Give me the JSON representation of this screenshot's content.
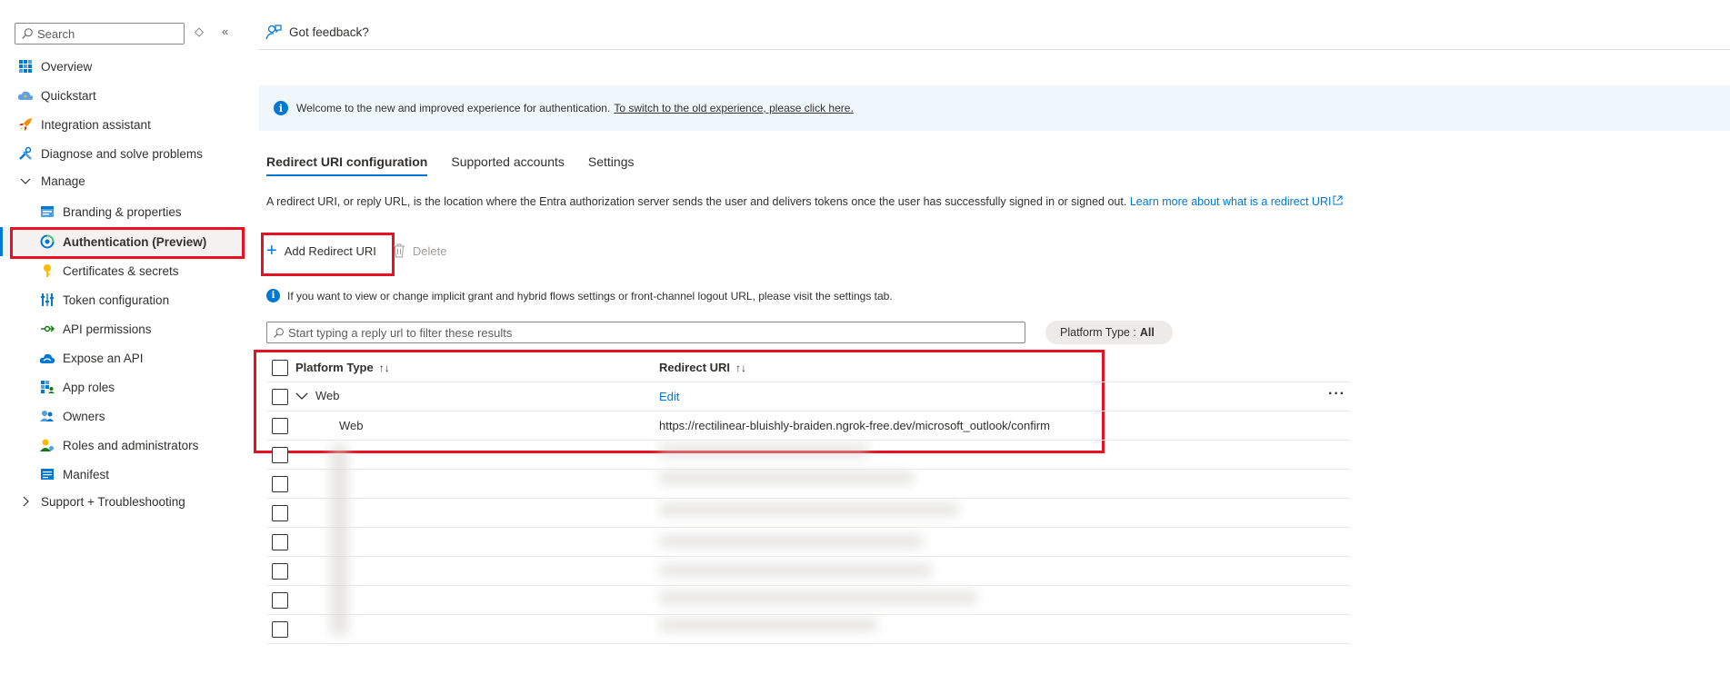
{
  "sidebar": {
    "search_placeholder": "Search",
    "items": [
      {
        "label": "Overview"
      },
      {
        "label": "Quickstart"
      },
      {
        "label": "Integration assistant"
      },
      {
        "label": "Diagnose and solve problems"
      },
      {
        "label": "Manage"
      },
      {
        "label": "Branding & properties"
      },
      {
        "label": "Authentication (Preview)"
      },
      {
        "label": "Certificates & secrets"
      },
      {
        "label": "Token configuration"
      },
      {
        "label": "API permissions"
      },
      {
        "label": "Expose an API"
      },
      {
        "label": "App roles"
      },
      {
        "label": "Owners"
      },
      {
        "label": "Roles and administrators"
      },
      {
        "label": "Manifest"
      },
      {
        "label": "Support + Troubleshooting"
      }
    ]
  },
  "header": {
    "feedback_label": "Got feedback?"
  },
  "banner": {
    "text": "Welcome to the new and improved experience for authentication.",
    "link": "To switch to the old experience, please click here."
  },
  "tabs": [
    "Redirect URI configuration",
    "Supported accounts",
    "Settings"
  ],
  "description": {
    "text": "A redirect URI, or reply URL, is the location where the Entra authorization server sends the user and delivers tokens once the user has successfully signed in or signed out.",
    "link": "Learn more about what is a redirect URI"
  },
  "toolbar": {
    "add_label": "Add Redirect URI",
    "delete_label": "Delete"
  },
  "note": "If you want to view or change implicit grant and hybrid flows settings or front-channel logout URL, please visit the settings tab.",
  "filter": {
    "placeholder": "Start typing a reply url to filter these results",
    "platform_label": "Platform Type :",
    "platform_value": "All"
  },
  "table": {
    "col_platform": "Platform Type",
    "col_uri": "Redirect URI",
    "sort_icon": "↑↓",
    "group_label": "Web",
    "group_action": "Edit",
    "row_platform": "Web",
    "row_uri": "https://rectilinear-bluishly-braiden.ngrok-free.dev/microsoft_outlook/confirm"
  },
  "colors": {
    "accent": "#0078d4",
    "highlight": "#e81123"
  }
}
